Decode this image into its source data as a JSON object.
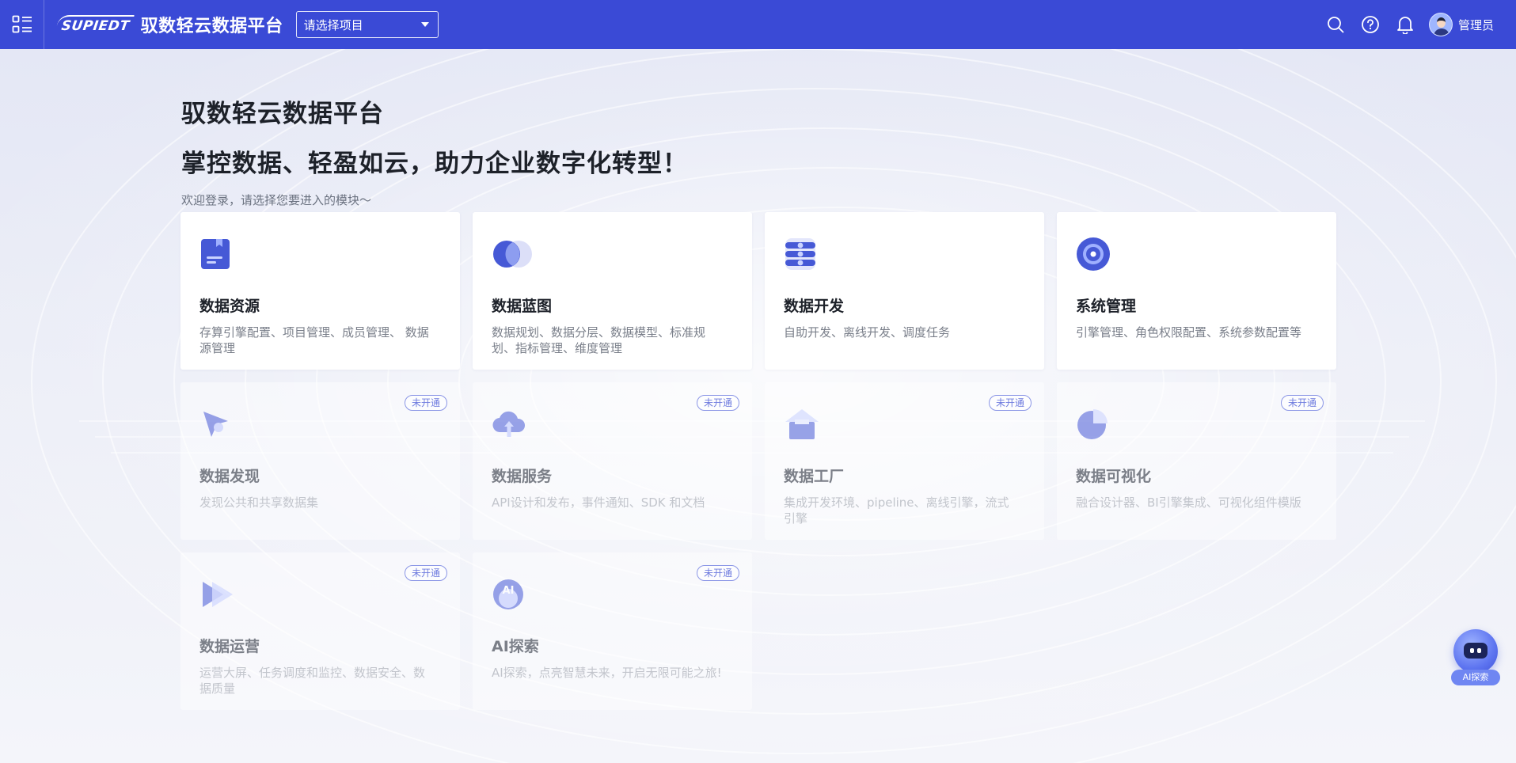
{
  "header": {
    "logo_text": "SUPIEDT",
    "app_title": "驭数轻云数据平台",
    "project_select_value": "请选择项目",
    "user_name": "管理员"
  },
  "icons": [
    "menu-grid-icon",
    "search-icon",
    "help-icon",
    "bell-icon",
    "avatar"
  ],
  "hero": {
    "title": "驭数轻云数据平台",
    "slogan": "掌控数据、轻盈如云，助力企业数字化转型！",
    "subtitle": "欢迎登录，请选择您要进入的模块～"
  },
  "modules": [
    {
      "name": "数据资源",
      "desc": "存算引擎配置、项目管理、成员管理、 数据源管理",
      "enabled": true,
      "icon": "book-icon"
    },
    {
      "name": "数据蓝图",
      "desc": "数据规划、数据分层、数据模型、标准规划、指标管理、维度管理",
      "enabled": true,
      "icon": "overlap-circles-icon"
    },
    {
      "name": "数据开发",
      "desc": "自助开发、离线开发、调度任务",
      "enabled": true,
      "icon": "server-stack-icon"
    },
    {
      "name": "系统管理",
      "desc": "引擎管理、角色权限配置、系统参数配置等",
      "enabled": true,
      "icon": "disc-icon"
    },
    {
      "name": "数据发现",
      "desc": "发现公共和共享数据集",
      "enabled": false,
      "badge": "未开通",
      "icon": "send-icon"
    },
    {
      "name": "数据服务",
      "desc": "API设计和发布，事件通知、SDK 和文档",
      "enabled": false,
      "badge": "未开通",
      "icon": "cloud-upload-icon"
    },
    {
      "name": "数据工厂",
      "desc": "集成开发环境、pipeline、离线引擎，流式引擎",
      "enabled": false,
      "badge": "未开通",
      "icon": "factory-icon"
    },
    {
      "name": "数据可视化",
      "desc": "融合设计器、BI引擎集成、可视化组件模版",
      "enabled": false,
      "badge": "未开通",
      "icon": "pie-chart-icon"
    },
    {
      "name": "数据运营",
      "desc": "运营大屏、任务调度和监控、数据安全、数据质量",
      "enabled": false,
      "badge": "未开通",
      "icon": "play-icon"
    },
    {
      "name": "AI探索",
      "desc": "AI探索，点亮智慧未来，开启无限可能之旅!",
      "enabled": false,
      "badge": "未开通",
      "icon": "ai-icon"
    }
  ],
  "ai_float": {
    "label": "AI探索"
  },
  "colors": {
    "topbar": "#3a4ad6",
    "accent": "#4a5ee0",
    "badge": "#6f7cdf"
  }
}
